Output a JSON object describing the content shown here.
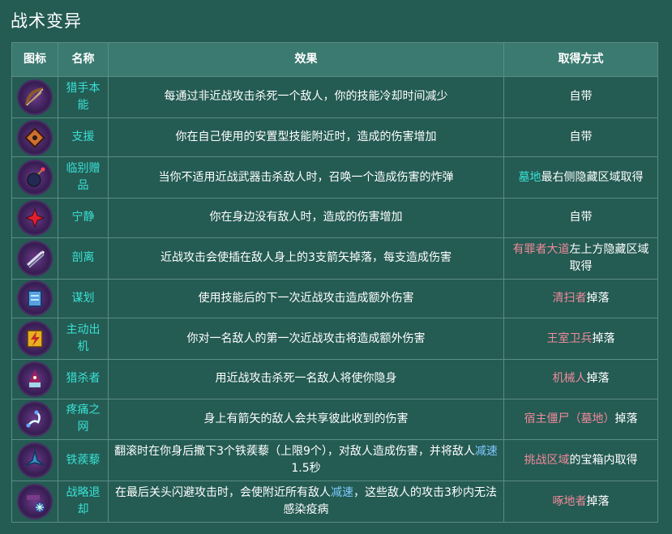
{
  "title": "战术变异",
  "headers": {
    "icon": "图标",
    "name": "名称",
    "effect": "效果",
    "source": "取得方式"
  },
  "rows": [
    {
      "name": "猎手本能",
      "icon": "bow-icon",
      "effect": "每通过非近战攻击杀死一个敌人，你的技能冷却时间减少",
      "source": [
        {
          "t": "自带",
          "c": "w"
        }
      ]
    },
    {
      "name": "支援",
      "icon": "support-icon",
      "effect": "你在自己使用的安置型技能附近时，造成的伤害增加",
      "source": [
        {
          "t": "自带",
          "c": "w"
        }
      ]
    },
    {
      "name": "临别赠品",
      "icon": "bomb-icon",
      "effect": "当你不适用近战武器击杀敌人时，召唤一个造成伤害的炸弹",
      "source": [
        {
          "t": "墓地",
          "c": "teal"
        },
        {
          "t": "最右侧隐藏区域取得",
          "c": "w"
        }
      ]
    },
    {
      "name": "宁静",
      "icon": "serenity-icon",
      "effect": "你在身边没有敌人时，造成的伤害增加",
      "source": [
        {
          "t": "自带",
          "c": "w"
        }
      ]
    },
    {
      "name": "剖离",
      "icon": "arrows-icon",
      "effect": "近战攻击会使插在敌人身上的3支箭矢掉落，每支造成伤害",
      "source": [
        {
          "t": "有罪者大道",
          "c": "pink"
        },
        {
          "t": "左上方隐藏区域取得",
          "c": "w"
        }
      ]
    },
    {
      "name": "谋划",
      "icon": "scheme-icon",
      "effect": "使用技能后的下一次近战攻击造成额外伤害",
      "source": [
        {
          "t": "清扫者",
          "c": "pink"
        },
        {
          "t": "掉落",
          "c": "w"
        }
      ]
    },
    {
      "name": "主动出机",
      "icon": "lightning-icon",
      "effect": "你对一名敌人的第一次近战攻击将造成额外伤害",
      "source": [
        {
          "t": "王室卫兵",
          "c": "pink"
        },
        {
          "t": "掉落",
          "c": "w"
        }
      ]
    },
    {
      "name": "猎杀者",
      "icon": "stalker-icon",
      "effect": "用近战攻击杀死一名敌人将使你隐身",
      "source": [
        {
          "t": "机械人",
          "c": "pink"
        },
        {
          "t": "掉落",
          "c": "w"
        }
      ]
    },
    {
      "name": "疼痛之网",
      "icon": "web-icon",
      "effect": "身上有箭矢的敌人会共享彼此收到的伤害",
      "source": [
        {
          "t": "宿主僵尸（墓地）",
          "c": "pink"
        },
        {
          "t": "掉落",
          "c": "w"
        }
      ]
    },
    {
      "name": "铁蒺藜",
      "icon": "caltrops-icon",
      "effect": [
        {
          "t": "翻滚时在你身后撒下3个铁蒺藜（上限9个），对敌人造成伤害，并将敌人",
          "c": "w"
        },
        {
          "t": "减速",
          "c": "blue"
        },
        {
          "t": "1.5秒",
          "c": "w"
        }
      ],
      "source": [
        {
          "t": "挑战区域",
          "c": "pink"
        },
        {
          "t": "的宝箱内取得",
          "c": "w"
        }
      ]
    },
    {
      "name": "战略退却",
      "icon": "retreat-icon",
      "effect": [
        {
          "t": "在最后关头闪避攻击时，会使附近所有敌人",
          "c": "w"
        },
        {
          "t": "减速",
          "c": "blue"
        },
        {
          "t": "，这些敌人的攻击3秒内无法感染疫病",
          "c": "w"
        }
      ],
      "source": [
        {
          "t": "啄地者",
          "c": "pink"
        },
        {
          "t": "掉落",
          "c": "w"
        }
      ]
    }
  ],
  "colors": {
    "background": "#245b53",
    "header": "#3a7a70",
    "name": "#3ae0d4",
    "link": "#f08a9a",
    "keyword": "#7fc8ff"
  }
}
